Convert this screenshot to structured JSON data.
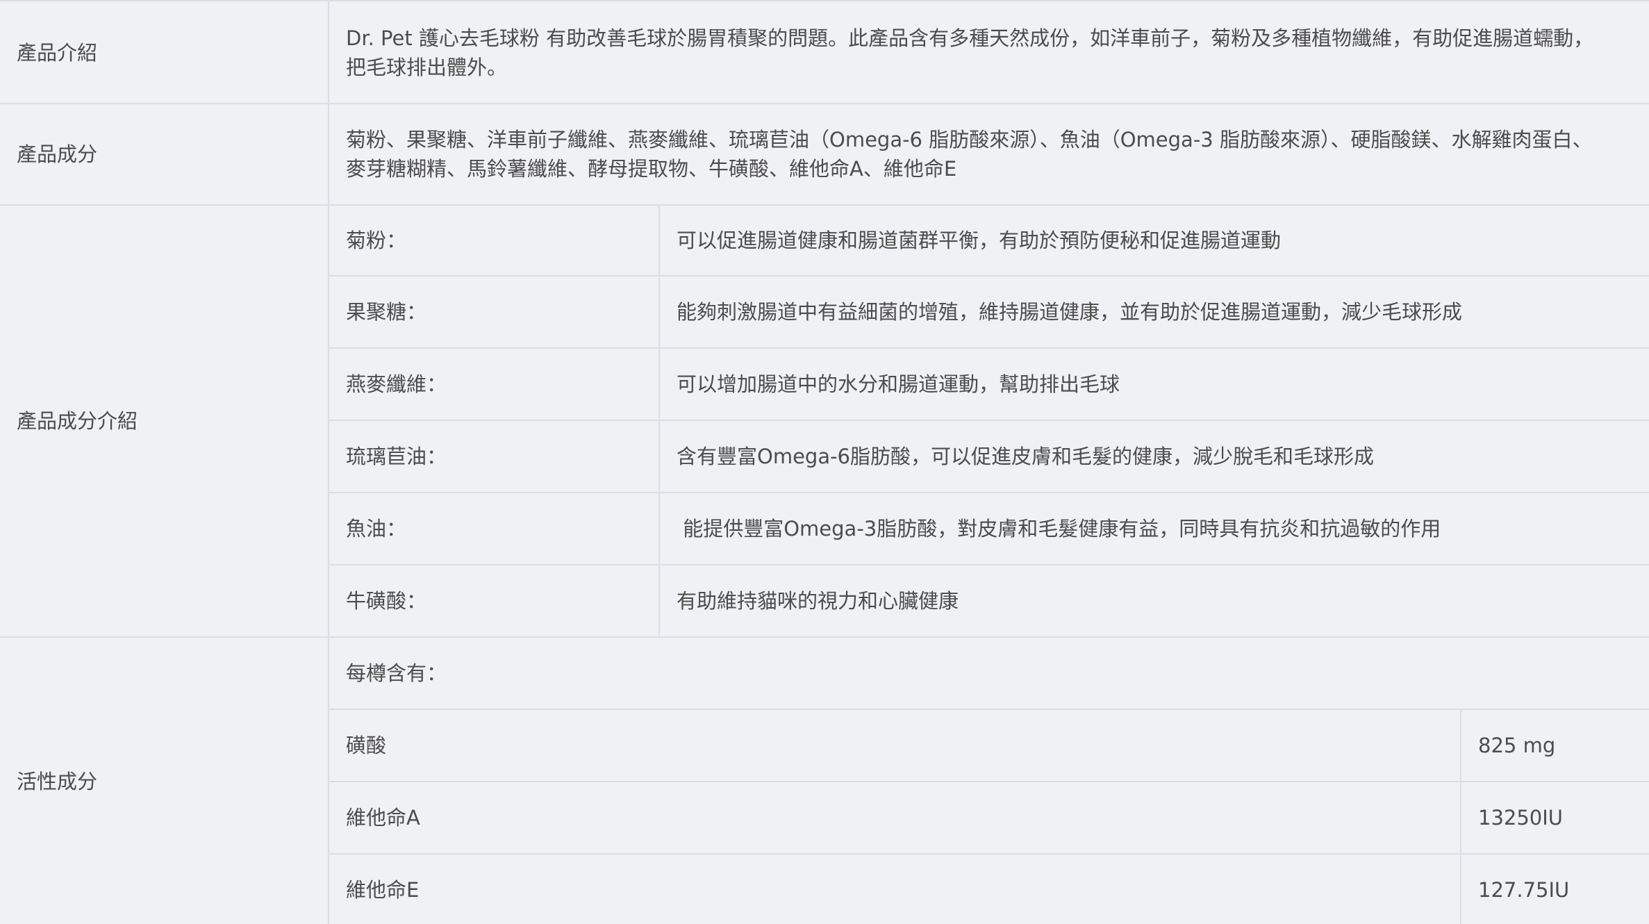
{
  "sections": {
    "intro": {
      "label": "產品介紹",
      "text_line1": "Dr. Pet 護心去毛球粉 有助改善毛球於腸胃積聚的問題。此產品含有多種天然成份，如洋車前子，菊粉及多種植物纖維，有助促進腸道蠕動，",
      "text_line2": "把毛球排出體外。"
    },
    "ingredients": {
      "label": "產品成分",
      "text_line1": "菊粉、果聚糖、洋車前子纖維、燕麥纖維、琉璃苣油（Omega-6 脂肪酸來源）、魚油（Omega-3 脂肪酸來源）、硬脂酸鎂、水解雞肉蛋白、",
      "text_line2": "麥芽糖糊精、馬鈴薯纖維、酵母提取物、牛磺酸、維他命A、維他命E"
    },
    "ingredient_details": {
      "label": "產品成分介紹",
      "rows": [
        {
          "name": "菊粉：",
          "desc": "可以促進腸道健康和腸道菌群平衡，有助於預防便秘和促進腸道運動"
        },
        {
          "name": "果聚糖：",
          "desc": "能夠刺激腸道中有益細菌的增殖，維持腸道健康，並有助於促進腸道運動，減少毛球形成"
        },
        {
          "name": "燕麥纖維：",
          "desc": "可以增加腸道中的水分和腸道運動，幫助排出毛球"
        },
        {
          "name": "琉璃苣油：",
          "desc": "含有豐富Omega-6脂肪酸，可以促進皮膚和毛髮的健康，減少脫毛和毛球形成"
        },
        {
          "name": "魚油：",
          "desc": " 能提供豐富Omega-3脂肪酸，對皮膚和毛髮健康有益，同時具有抗炎和抗過敏的作用"
        },
        {
          "name": "牛磺酸：",
          "desc": "有助維持貓咪的視力和心臟健康"
        }
      ]
    },
    "active": {
      "label": "活性成分",
      "header": "每樽含有：",
      "rows": [
        {
          "name": "磺酸",
          "amount": "825 mg"
        },
        {
          "name": "維他命A",
          "amount": "13250IU"
        },
        {
          "name": "維他命E",
          "amount": "127.75IU"
        }
      ]
    }
  }
}
